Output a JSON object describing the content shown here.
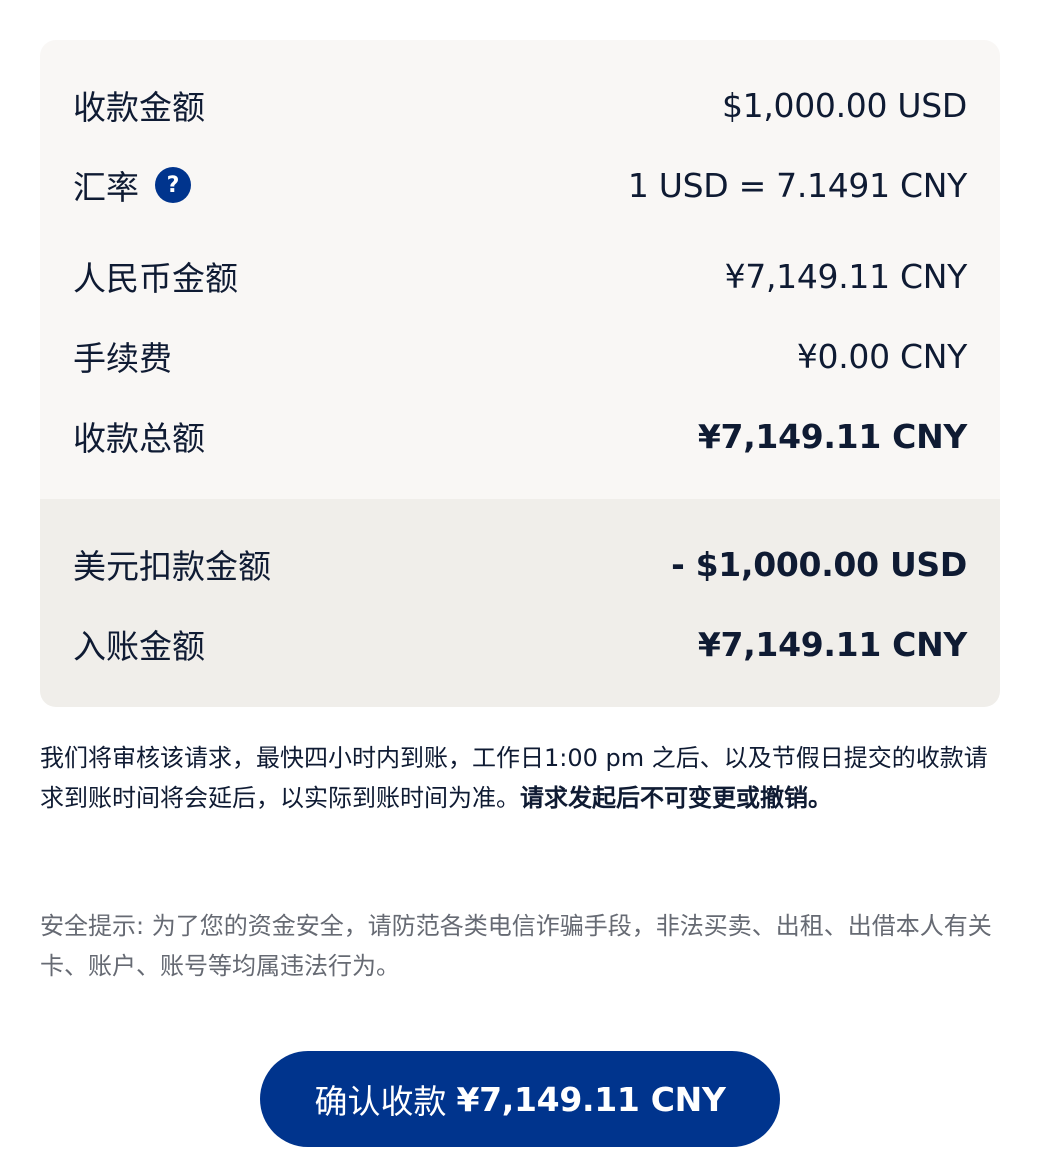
{
  "summary": {
    "rows": [
      {
        "label": "收款金额",
        "value": "$1,000.00 USD"
      },
      {
        "label": "汇率",
        "value": "1 USD = 7.1491 CNY",
        "help_icon": "question-icon"
      },
      {
        "label": "人民币金额",
        "value": "¥7,149.11 CNY"
      },
      {
        "label": "手续费",
        "value": "¥0.00 CNY"
      },
      {
        "label": "收款总额",
        "value": "¥7,149.11 CNY"
      }
    ],
    "settlement_rows": [
      {
        "label": "美元扣款金额",
        "value": "- $1,000.00 USD"
      },
      {
        "label": "入账金额",
        "value": "¥7,149.11 CNY"
      }
    ],
    "help_symbol": "?"
  },
  "notice": {
    "text": "我们将审核该请求，最快四小时内到账，工作日1:00 pm 之后、以及节假日提交的收款请求到账时间将会延后，以实际到账时间为准。",
    "bold_text": "请求发起后不可变更或撤销。"
  },
  "safety": {
    "text": "安全提示: 为了您的资金安全，请防范各类电信诈骗手段，非法买卖、出租、出借本人有关卡、账户、账号等均属违法行为。"
  },
  "confirm_button": {
    "label": "确认收款",
    "amount": "¥7,149.11 CNY"
  },
  "colors": {
    "primary": "#00348d",
    "card_top": "#f9f7f5",
    "card_bottom": "#f0eeea",
    "text": "#0f1b33",
    "muted": "#666a73"
  }
}
